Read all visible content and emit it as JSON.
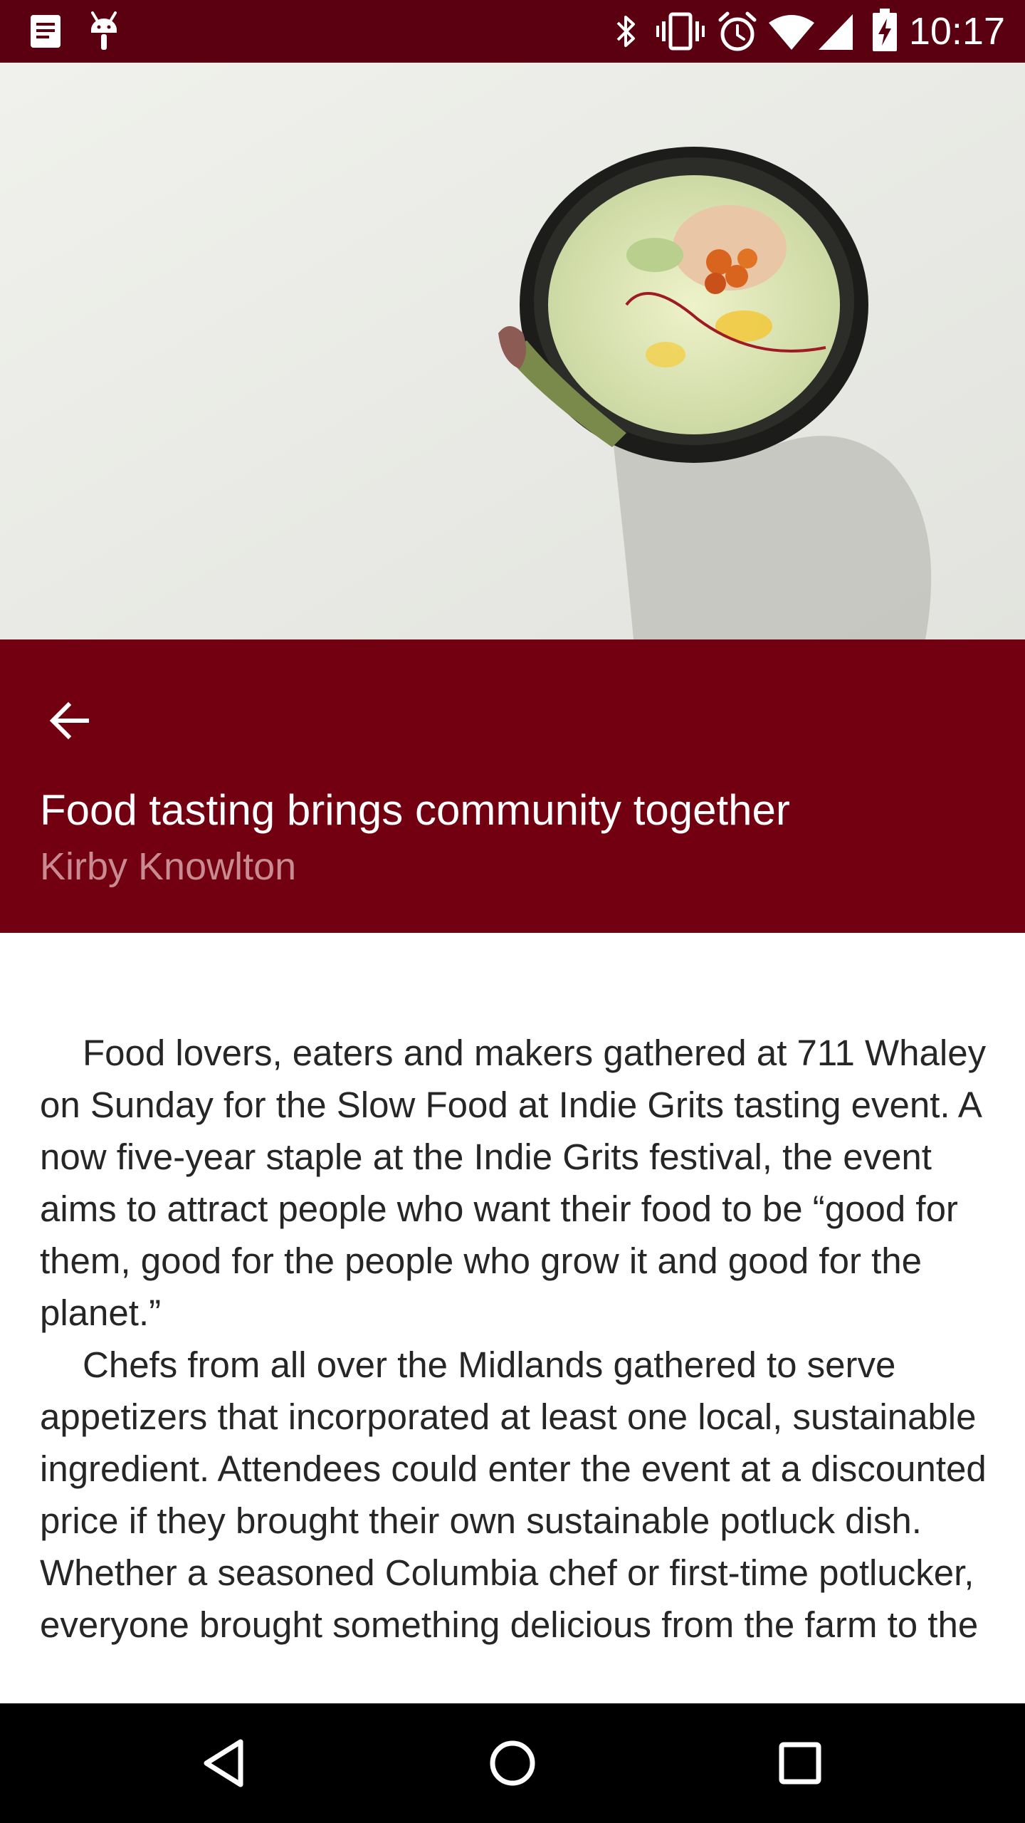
{
  "status_bar": {
    "time": "10:17",
    "left_icons": [
      "notes-notification-icon",
      "android-debug-icon"
    ],
    "right_icons": [
      "bluetooth-icon",
      "vibrate-icon",
      "alarm-icon",
      "wifi-icon",
      "cell-signal-icon",
      "battery-charging-icon"
    ]
  },
  "hero": {
    "icon": "hero-photo-food-bowl"
  },
  "article": {
    "title": "Food tasting brings community together",
    "author": "Kirby Knowlton",
    "paragraphs": [
      "Food lovers, eaters and makers gathered at 711 Whaley on Sunday for the Slow Food at Indie Grits tasting event. A now five-year staple at the Indie Grits festival, the event aims to attract people who want their food to be “good for them, good for the people who grow it and good for the planet.”",
      "Chefs from all over the Midlands gathered to serve appetizers that incorporated at least one local, sustainable ingredient. Attendees could enter the event at a discounted price if they brought their own sustainable potluck dish. Whether a seasoned Columbia chef or first-time potlucker, everyone brought something delicious from the farm to the"
    ]
  },
  "navigation": {
    "back_icon": "arrow-back-icon",
    "system": [
      "back-triangle-icon",
      "home-circle-icon",
      "recents-square-icon"
    ]
  },
  "colors": {
    "status_bar": "#5a0010",
    "header": "#720011",
    "author": "#c98a92",
    "body_text": "#262626",
    "nav_bar": "#000000"
  }
}
